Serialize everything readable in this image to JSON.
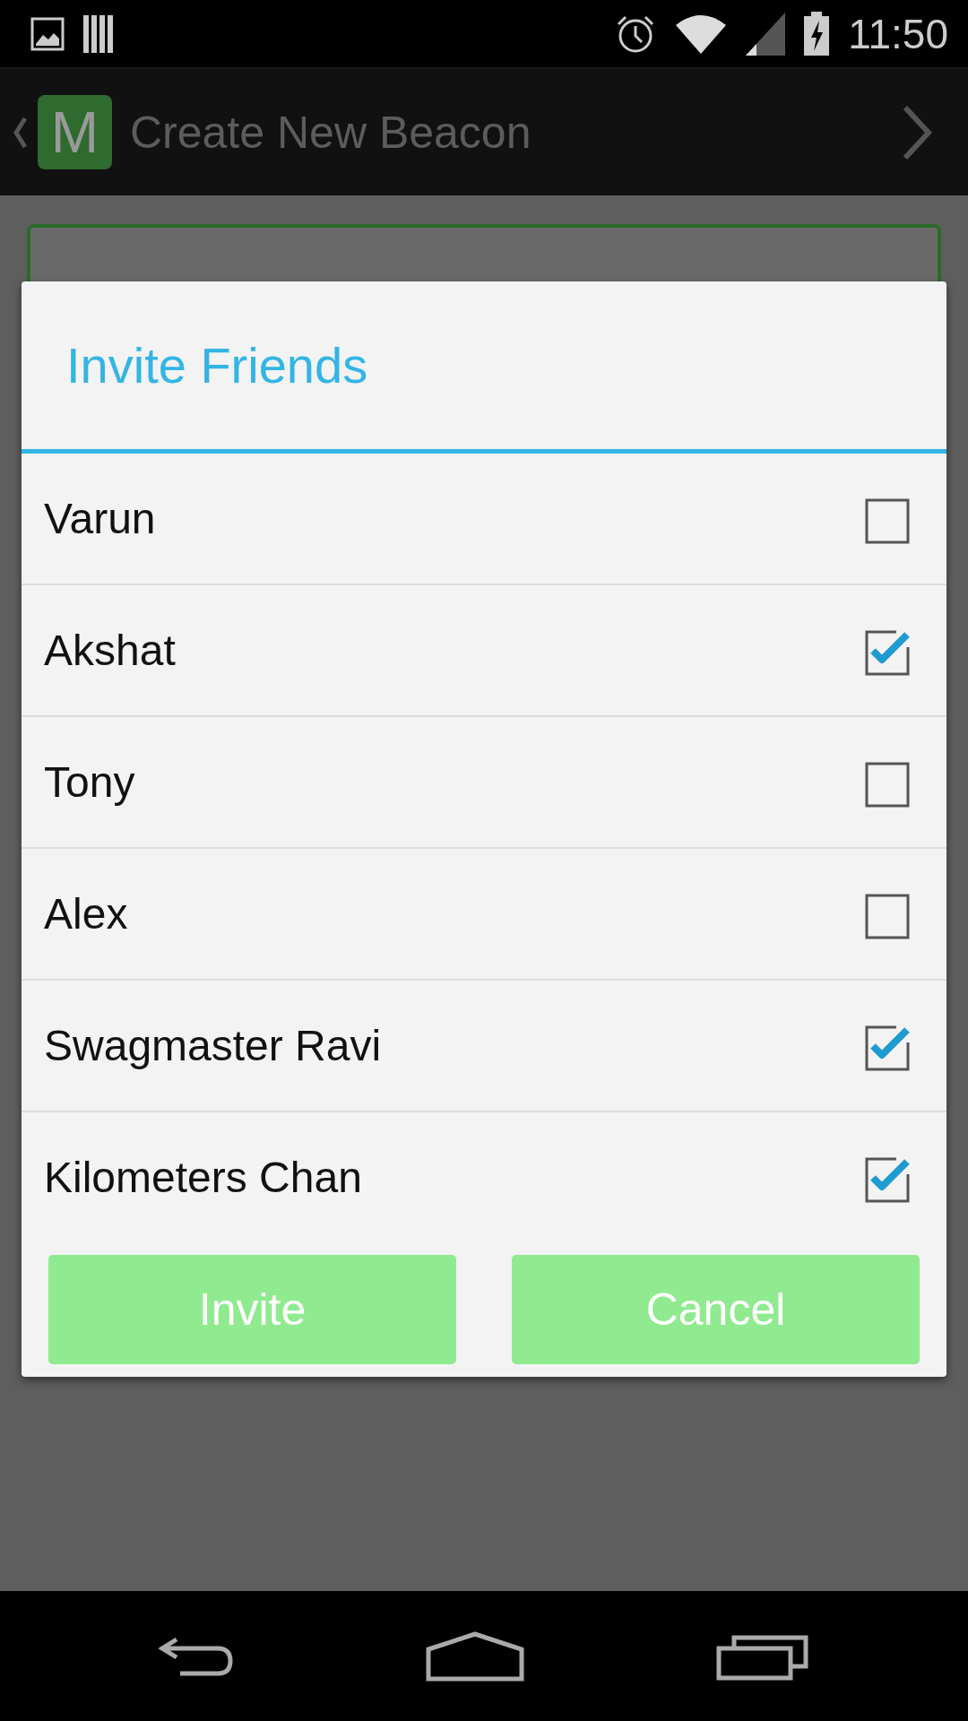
{
  "status_bar": {
    "time": "11:50"
  },
  "action_bar": {
    "logo": "M",
    "title": "Create New Beacon"
  },
  "dialog": {
    "title": "Invite Friends",
    "friends": [
      {
        "name": "Varun",
        "checked": false
      },
      {
        "name": "Akshat",
        "checked": true
      },
      {
        "name": "Tony",
        "checked": false
      },
      {
        "name": "Alex",
        "checked": false
      },
      {
        "name": "Swagmaster Ravi",
        "checked": true
      },
      {
        "name": "Kilometers Chan",
        "checked": true
      }
    ],
    "buttons": [
      "Invite",
      "Cancel"
    ]
  }
}
